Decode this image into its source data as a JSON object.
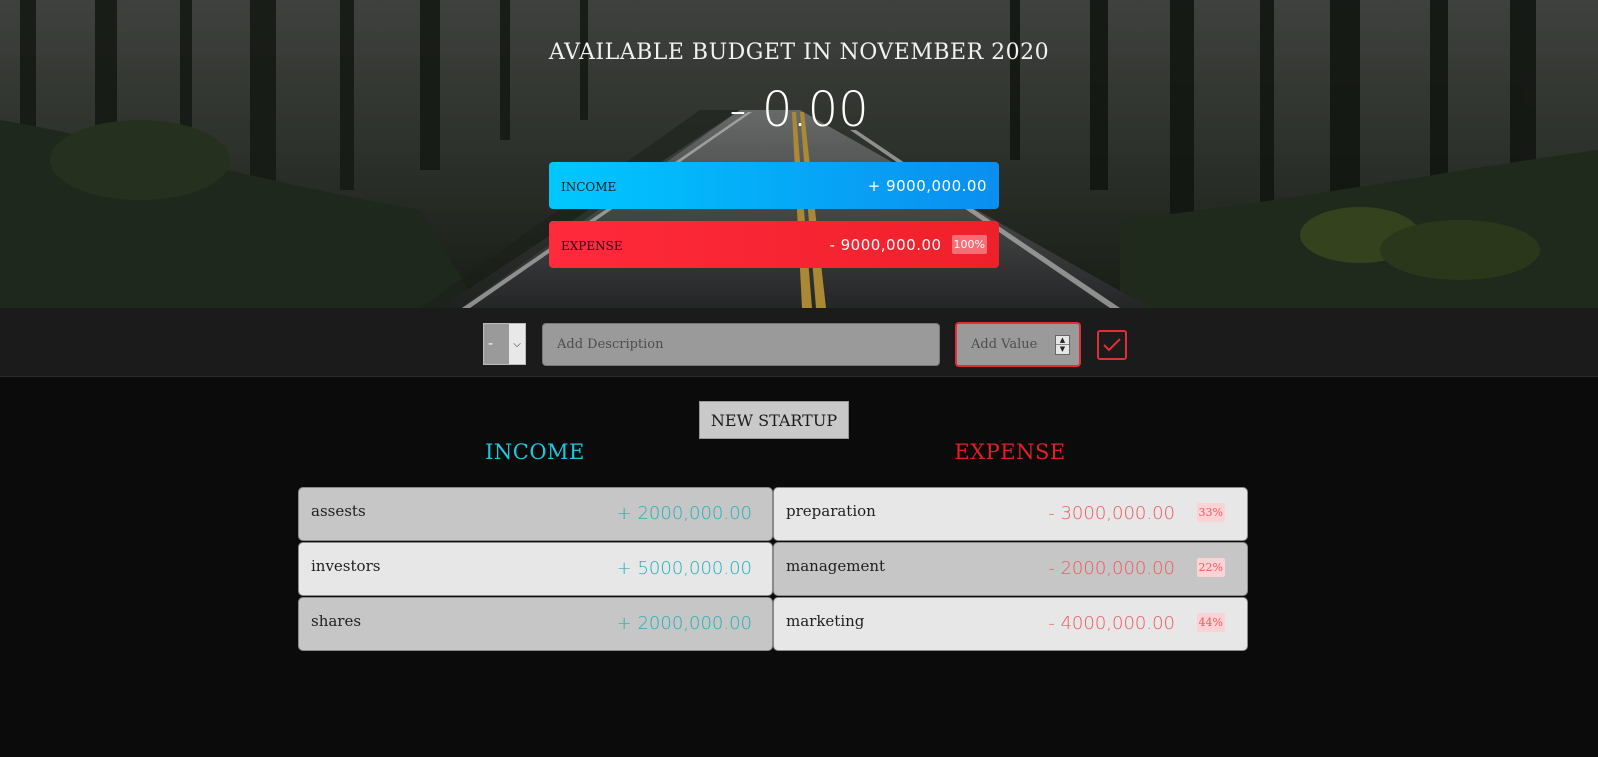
{
  "header": {
    "title": "AVAILABLE BUDGET IN NOVEMBER 2020",
    "budget": "- 0.00",
    "income_label": "INCOME",
    "income_value": "+ 9000,000.00",
    "expense_label": "EXPENSE",
    "expense_value": "- 9000,000.00",
    "expense_percentage": "100%"
  },
  "add_bar": {
    "type_value": "-",
    "description_placeholder": "Add Description",
    "value_placeholder": "Add Value",
    "submit_icon": "check-icon"
  },
  "lists": {
    "new_button_label": "NEW STARTUP",
    "income_title": "INCOME",
    "expense_title": "EXPENSE",
    "income_items": [
      {
        "description": "assests",
        "value": "+ 2000,000.00"
      },
      {
        "description": "investors",
        "value": "+ 5000,000.00"
      },
      {
        "description": "shares",
        "value": "+ 2000,000.00"
      }
    ],
    "expense_items": [
      {
        "description": "preparation",
        "value": "- 3000,000.00",
        "percentage": "33%"
      },
      {
        "description": "management",
        "value": "- 2000,000.00",
        "percentage": "22%"
      },
      {
        "description": "marketing",
        "value": "- 4000,000.00",
        "percentage": "44%"
      }
    ]
  },
  "colors": {
    "income_accent": "#1ec8e0",
    "expense_accent": "#e3202a",
    "income_item_value": "#27b0b8",
    "expense_item_value": "#ef5a5f"
  }
}
